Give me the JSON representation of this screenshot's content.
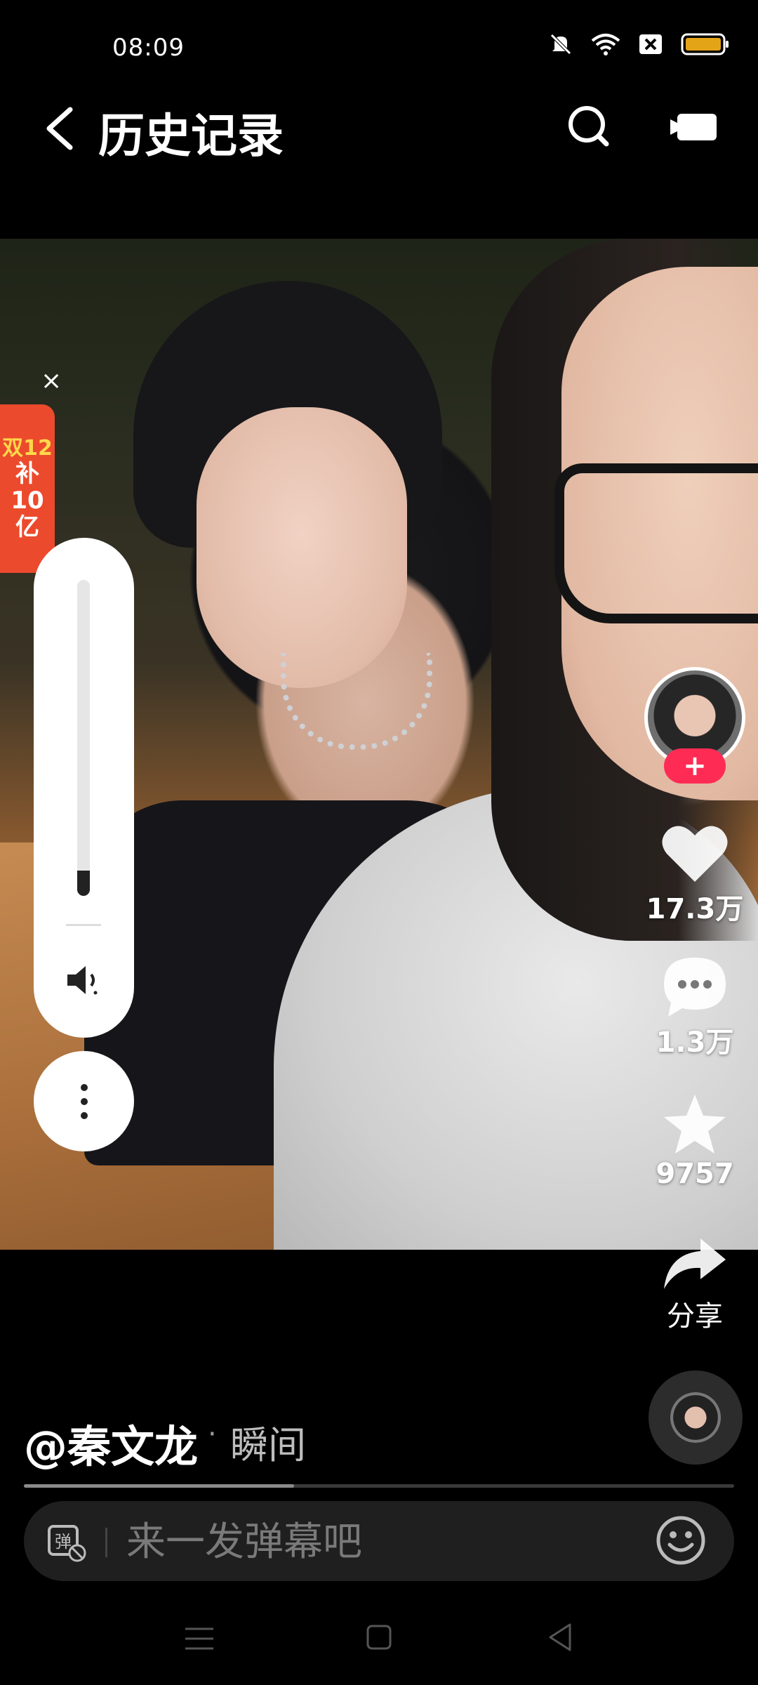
{
  "status_bar": {
    "time": "08:09",
    "icons": [
      "mute-icon",
      "wifi-icon",
      "sim-off-icon",
      "battery-icon"
    ],
    "battery_color": "#e4a418"
  },
  "header": {
    "title": "历史记录",
    "icons": [
      "back-icon",
      "search-icon",
      "video-camera-icon"
    ]
  },
  "promo": {
    "line1": "双12",
    "line2": "补",
    "line3": "10",
    "line4": "亿",
    "close": "×",
    "color": "#ec4a2c"
  },
  "volume": {
    "level_fraction": 0.08,
    "icons": [
      "speaker-icon",
      "more-vertical-icon"
    ]
  },
  "actions": {
    "like_count": "17.3万",
    "comment_count": "1.3万",
    "favorite_count": "9757",
    "share_label": "分享",
    "follow_symbol": "+",
    "follow_color": "#fe2c55"
  },
  "author": {
    "name": "@秦文龙",
    "separator": "·",
    "tag": "瞬间"
  },
  "progress": {
    "played_fraction": 0.38
  },
  "danmaku": {
    "placeholder": "来一发弹幕吧",
    "toggle_icon": "danmaku-off-icon",
    "emoji_icon": "emoji-icon"
  },
  "nav": {
    "icons": [
      "menu-icon",
      "home-icon",
      "back-triangle-icon"
    ]
  }
}
